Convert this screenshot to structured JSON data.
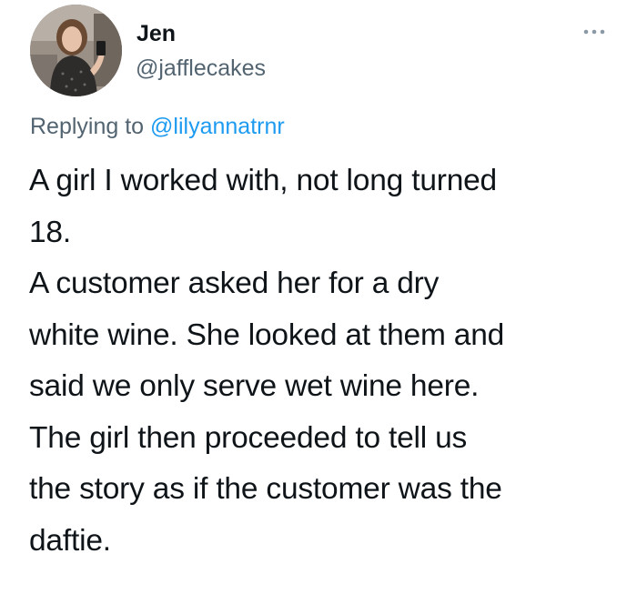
{
  "user": {
    "display_name": "Jen",
    "handle": "@jafflecakes"
  },
  "reply": {
    "prefix": "Replying to",
    "mention": "@lilyannatrnr"
  },
  "tweet": {
    "lines": [
      "A girl I worked with, not long turned",
      "18.",
      "A customer asked her for a dry",
      "white wine. She looked at them and",
      "said we only serve wet wine here.",
      "The girl then proceeded to tell us",
      "the story as if the customer was the",
      "daftie."
    ]
  },
  "icons": {
    "more": "more-options-icon",
    "avatar": "profile-photo"
  },
  "colors": {
    "name": "#0f1419",
    "secondary": "#536471",
    "link": "#1d9bf0",
    "body": "#0f1419"
  }
}
